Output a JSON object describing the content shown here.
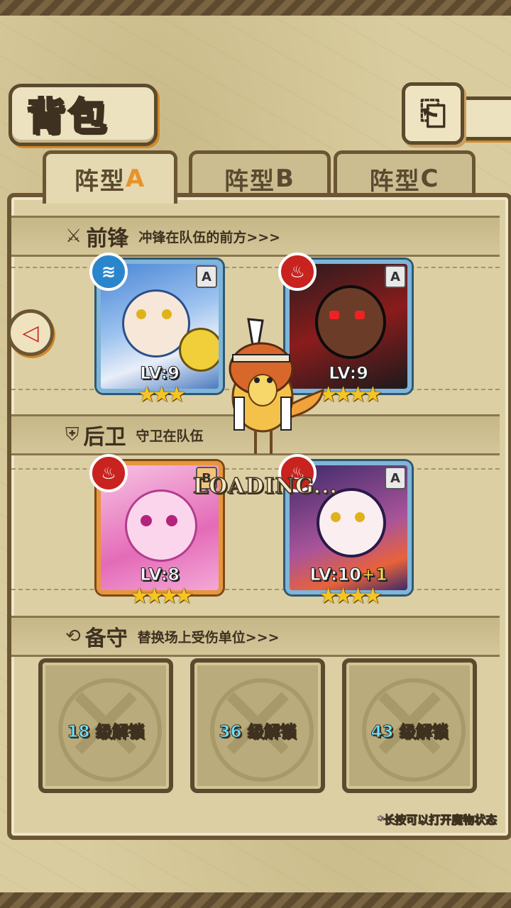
{
  "header": {
    "title": "背包",
    "back_icon": "return-arrow-icon"
  },
  "tabs": [
    {
      "prefix": "阵型",
      "letter": "A",
      "active": true
    },
    {
      "prefix": "阵型",
      "letter": "B",
      "active": false
    },
    {
      "prefix": "阵型",
      "letter": "C",
      "active": false
    }
  ],
  "sections": {
    "front": {
      "title": "前锋",
      "desc": "冲锋在队伍的前方>>>",
      "icon": "sword-icon"
    },
    "back": {
      "title": "后卫",
      "desc": "守卫在队伍",
      "icon": "shield-icon"
    },
    "reserve": {
      "title": "备守",
      "desc": "替换场上受伤单位>>>",
      "icon": "swap-icon"
    }
  },
  "monsters": [
    {
      "element": "water",
      "rank": "A",
      "level": "LV:9",
      "plus": "",
      "stars": "★★★",
      "colors": [
        "#3a6fc4",
        "#e9eef8"
      ]
    },
    {
      "element": "fire",
      "rank": "A",
      "level": "LV:9",
      "plus": "",
      "stars": "★★★★",
      "colors": [
        "#1d1a1c",
        "#8a1c1c"
      ]
    },
    {
      "element": "fire",
      "rank": "B",
      "level": "LV:8",
      "plus": "",
      "stars": "★★★★",
      "colors": [
        "#f3a9d6",
        "#e46bb8"
      ]
    },
    {
      "element": "fire",
      "rank": "A",
      "level": "LV:10",
      "plus": "+1",
      "stars": "★★★★",
      "colors": [
        "#3d2a6a",
        "#e9a6c6"
      ]
    }
  ],
  "locked_slots": [
    {
      "level": "18",
      "label": "级解锁"
    },
    {
      "level": "36",
      "label": "级解锁"
    },
    {
      "level": "43",
      "label": "级解锁"
    }
  ],
  "hint": "*长按可以打开魔物状态",
  "loading": "LOADING..."
}
